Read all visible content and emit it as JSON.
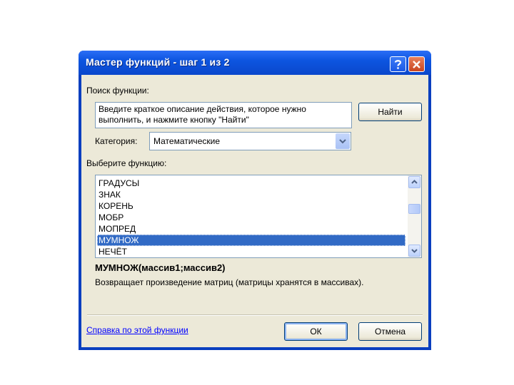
{
  "window": {
    "title": "Мастер функций - шаг 1 из 2",
    "accent_color": "#0a47cc",
    "help_icon": "question-mark-icon",
    "close_icon": "close-x-icon"
  },
  "search": {
    "label": "Поиск функции:",
    "description": "Введите краткое описание действия, которое нужно выполнить, и нажмите кнопку \"Найти\"",
    "find_button": "Найти"
  },
  "category": {
    "label": "Категория:",
    "selected": "Математические"
  },
  "function_list": {
    "label": "Выберите функцию:",
    "items": [
      "ГРАДУСЫ",
      "ЗНАК",
      "КОРЕНЬ",
      "МОБР",
      "МОПРЕД",
      "МУМНОЖ",
      "НЕЧЁТ"
    ],
    "selected_index": 5
  },
  "details": {
    "signature": "МУМНОЖ(массив1;массив2)",
    "description": "Возвращает произведение матриц (матрицы хранятся в массивах)."
  },
  "footer": {
    "help_link": "Справка по этой функции",
    "ok_button": "ОК",
    "cancel_button": "Отмена"
  }
}
